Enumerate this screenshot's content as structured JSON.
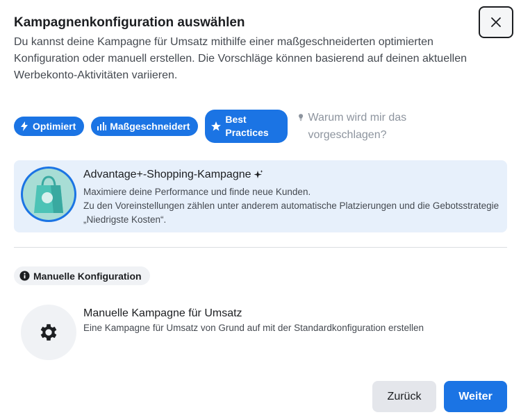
{
  "dialog": {
    "title": "Kampagnenkonfiguration auswählen",
    "description": "Du kannst deine Kampagne für Umsatz mithilfe einer maßgeschneiderten optimierten Konfiguration oder manuell erstellen. Die Vorschläge können basierend auf deinen aktuellen Werbekonto-Aktivitäten variieren.",
    "close_icon": "close-icon"
  },
  "badges": {
    "optimized": "Optimiert",
    "tailored": "Maßgeschneidert",
    "best_practices": "Best\nPractices",
    "why_text": "Warum wird mir das vorgeschlagen?"
  },
  "advantage": {
    "title": "Advantage+-Shopping-Kampagne",
    "line1": "Maximiere deine Performance und finde neue Kunden.",
    "line2": "Zu den Voreinstellungen zählen unter anderem automatische Platzierungen und die Gebotsstrategie „Niedrigste Kosten“."
  },
  "manual": {
    "chip_label": "Manuelle Konfiguration",
    "title": "Manuelle Kampagne für Umsatz",
    "text": "Eine Kampagne für Umsatz von Grund auf mit der Standardkonfiguration erstellen"
  },
  "footer": {
    "back_label": "Zurück",
    "next_label": "Weiter"
  },
  "colors": {
    "primary": "#1b74e4",
    "card_bg": "#e7f0fb",
    "neutral_bg": "#f0f2f5"
  }
}
